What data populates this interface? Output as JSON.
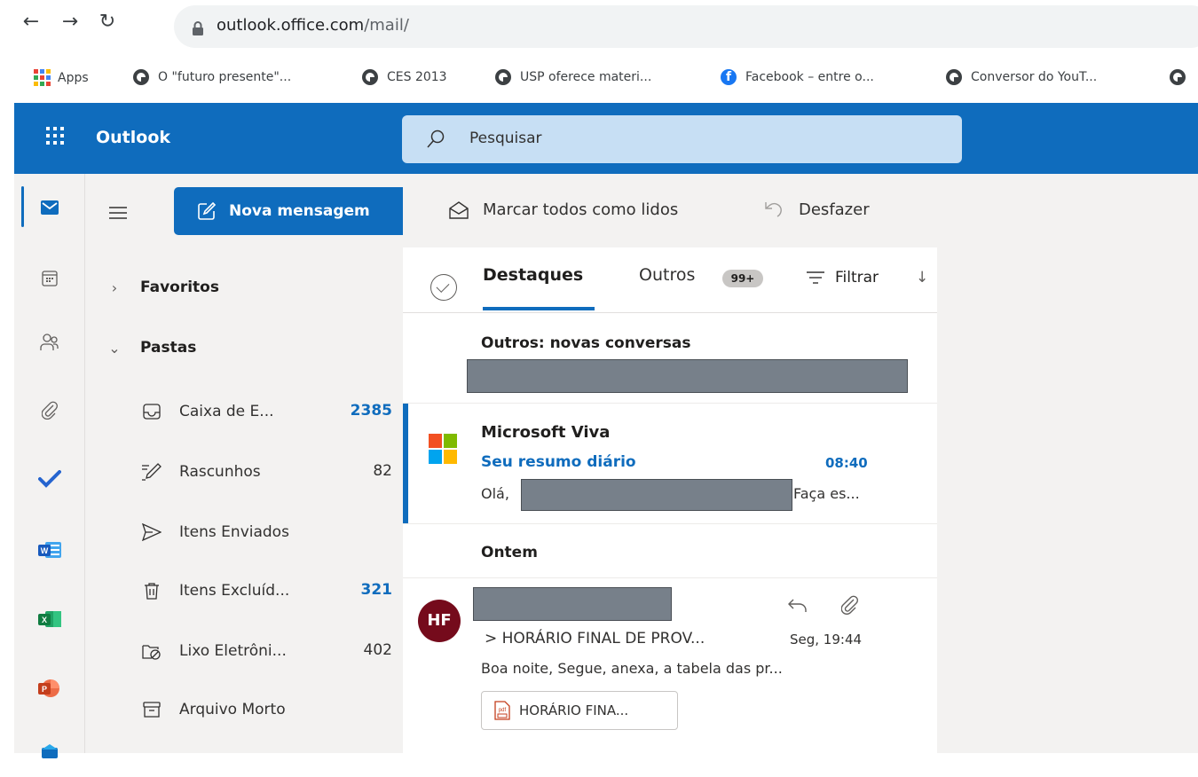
{
  "browser": {
    "url_host": "outlook.office.com",
    "url_path": "/mail/",
    "bookmarks": [
      {
        "label": "Apps",
        "icon": "apps-grid-icon"
      },
      {
        "label": "O \"futuro presente\"...",
        "icon": "globe-icon"
      },
      {
        "label": "CES 2013",
        "icon": "globe-icon"
      },
      {
        "label": "USP oferece materi...",
        "icon": "globe-icon"
      },
      {
        "label": "Facebook – entre o...",
        "icon": "facebook-icon"
      },
      {
        "label": "Conversor do YouT...",
        "icon": "globe-icon"
      }
    ]
  },
  "header": {
    "app_name": "Outlook",
    "search_placeholder": "Pesquisar",
    "accent": "#0f6cbd"
  },
  "toolbar": {
    "new_message": "Nova mensagem",
    "mark_all_read": "Marcar todos como lidos",
    "undo": "Desfazer"
  },
  "folder_pane": {
    "favorites": "Favoritos",
    "folders": "Pastas",
    "items": [
      {
        "label": "Caixa de E...",
        "count": "2385",
        "icon": "inbox-icon"
      },
      {
        "label": "Rascunhos",
        "count": "82",
        "icon": "drafts-icon"
      },
      {
        "label": "Itens Enviados",
        "count": "",
        "icon": "sent-icon"
      },
      {
        "label": "Itens Excluíd...",
        "count": "321",
        "icon": "trash-icon"
      },
      {
        "label": "Lixo Eletrôni...",
        "count": "402",
        "icon": "junk-icon"
      },
      {
        "label": "Arquivo Morto",
        "count": "",
        "icon": "archive-icon"
      }
    ]
  },
  "message_list": {
    "tab_focused": "Destaques",
    "tab_other": "Outros",
    "other_badge": "99+",
    "filter": "Filtrar",
    "other_header": "Outros: novas conversas",
    "messages": [
      {
        "sender": "Microsoft Viva",
        "subject": "Seu resumo diário",
        "time": "08:40",
        "preview_start": "Olá,",
        "preview_end": "Faça es..."
      }
    ],
    "group_yesterday": "Ontem",
    "yesterday_messages": [
      {
        "avatar_initials": "HF",
        "subject": "> HORÁRIO FINAL DE PROV...",
        "time": "Seg, 19:44",
        "preview": "Boa noite, Segue, anexa, a tabela das pr...",
        "attachment": "HORÁRIO FINA..."
      }
    ]
  }
}
